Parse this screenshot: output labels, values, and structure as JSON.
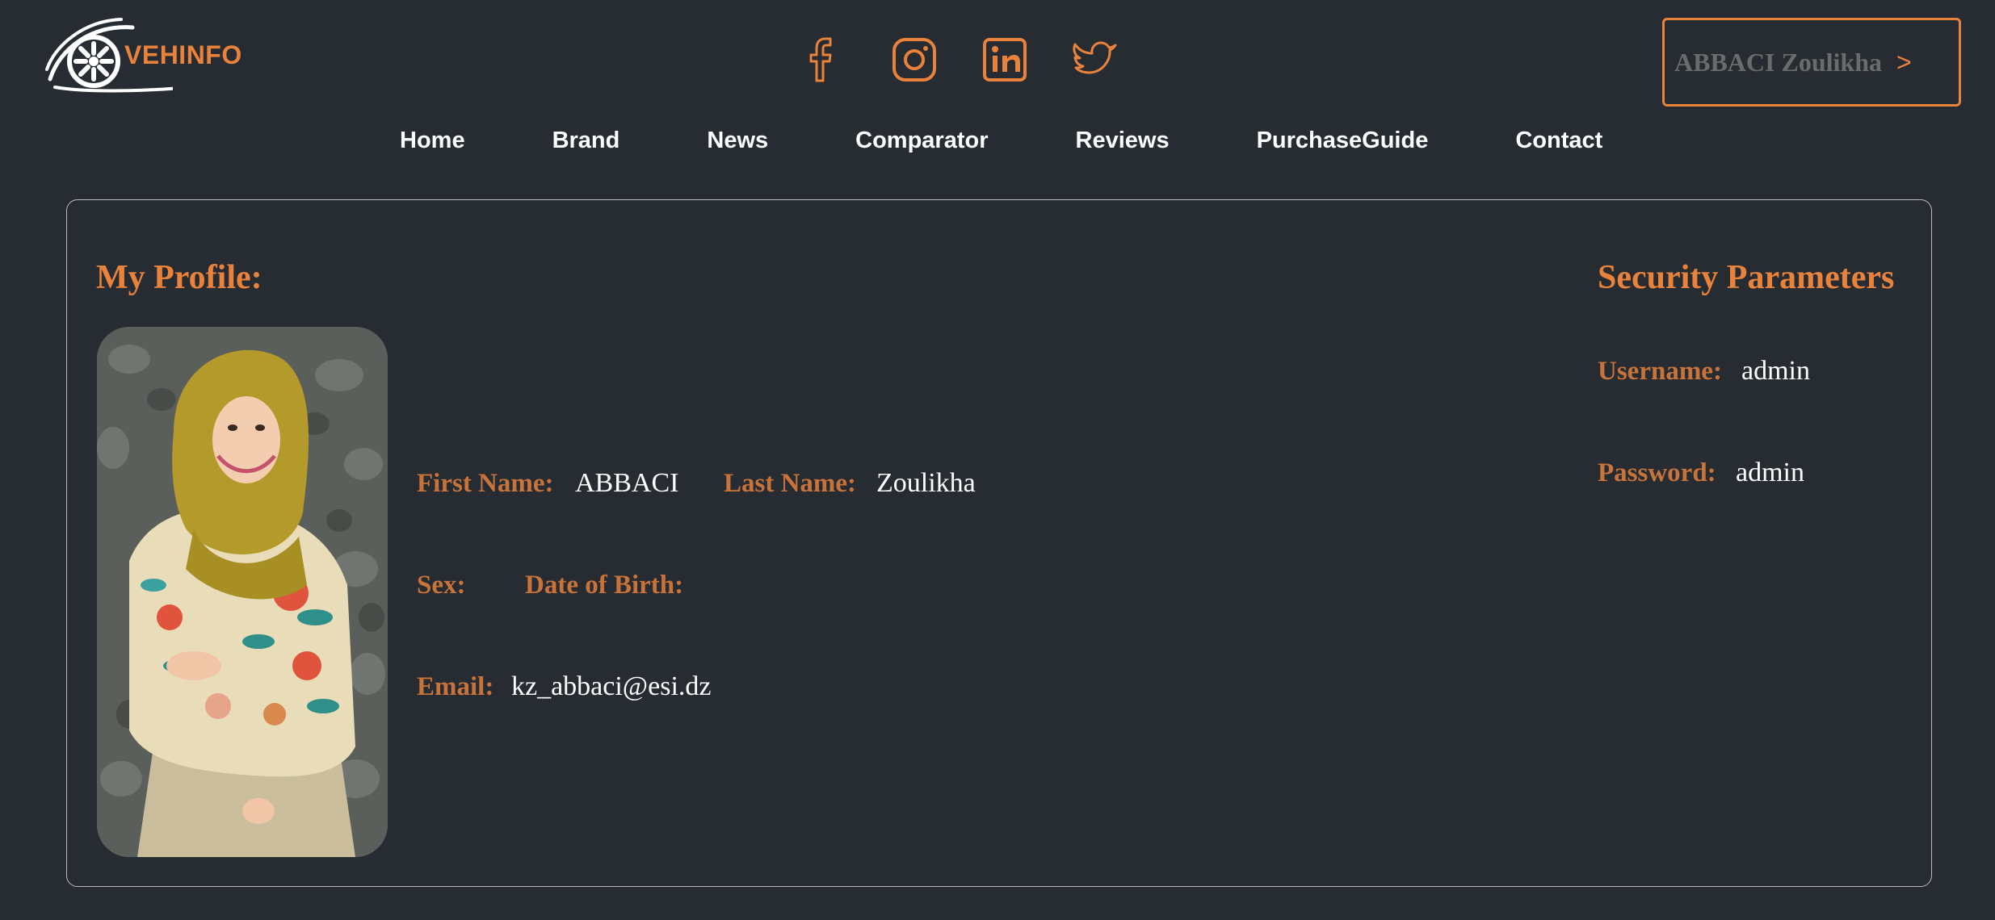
{
  "brand": {
    "logo_text": "VEHINFO",
    "accent_color": "#e9823a",
    "background_color": "#272c33"
  },
  "socials": [
    {
      "name": "facebook-icon"
    },
    {
      "name": "instagram-icon"
    },
    {
      "name": "linkedin-icon"
    },
    {
      "name": "twitter-icon"
    }
  ],
  "user_button": {
    "label": "ABBACI Zoulikha",
    "chevron": ">"
  },
  "nav": {
    "items": [
      "Home",
      "Brand",
      "News",
      "Comparator",
      "Reviews",
      "PurchaseGuide",
      "Contact"
    ]
  },
  "profile": {
    "title": "My Profile:",
    "first_name_label": "First Name:",
    "first_name": "ABBACI",
    "last_name_label": "Last Name:",
    "last_name": "Zoulikha",
    "sex_label": "Sex:",
    "sex": "",
    "dob_label": "Date of Birth:",
    "dob": "",
    "email_label": "Email:",
    "email": "kz_abbaci@esi.dz"
  },
  "security": {
    "title": "Security Parameters",
    "username_label": "Username:",
    "username": "admin",
    "password_label": "Password:",
    "password": "admin"
  }
}
